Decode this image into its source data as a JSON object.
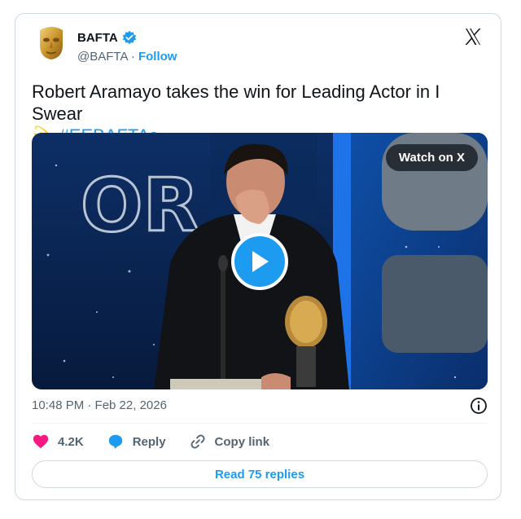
{
  "account": {
    "name": "BAFTA",
    "handle": "@BAFTA",
    "separator": "·",
    "follow_label": "Follow"
  },
  "tweet": {
    "text": "Robert Aramayo takes the win for Leading Actor in I Swear",
    "emoji": "💫",
    "hashtag": "#EEBAFTAs"
  },
  "media": {
    "watch_label": "Watch on X"
  },
  "timestamp": "10:48 PM · Feb 22, 2026",
  "actions": {
    "likes": "4.2K",
    "reply_label": "Reply",
    "copy_label": "Copy link"
  },
  "read_replies_label": "Read 75 replies",
  "colors": {
    "accent": "#1d9bf0",
    "like": "#f91880",
    "secondary_text": "#536471",
    "border": "#cfd9de"
  },
  "icons": [
    "bafta-mask-avatar",
    "verified-badge-icon",
    "x-logo-icon",
    "play-icon",
    "info-icon",
    "heart-icon",
    "reply-bubble-icon",
    "link-icon"
  ]
}
